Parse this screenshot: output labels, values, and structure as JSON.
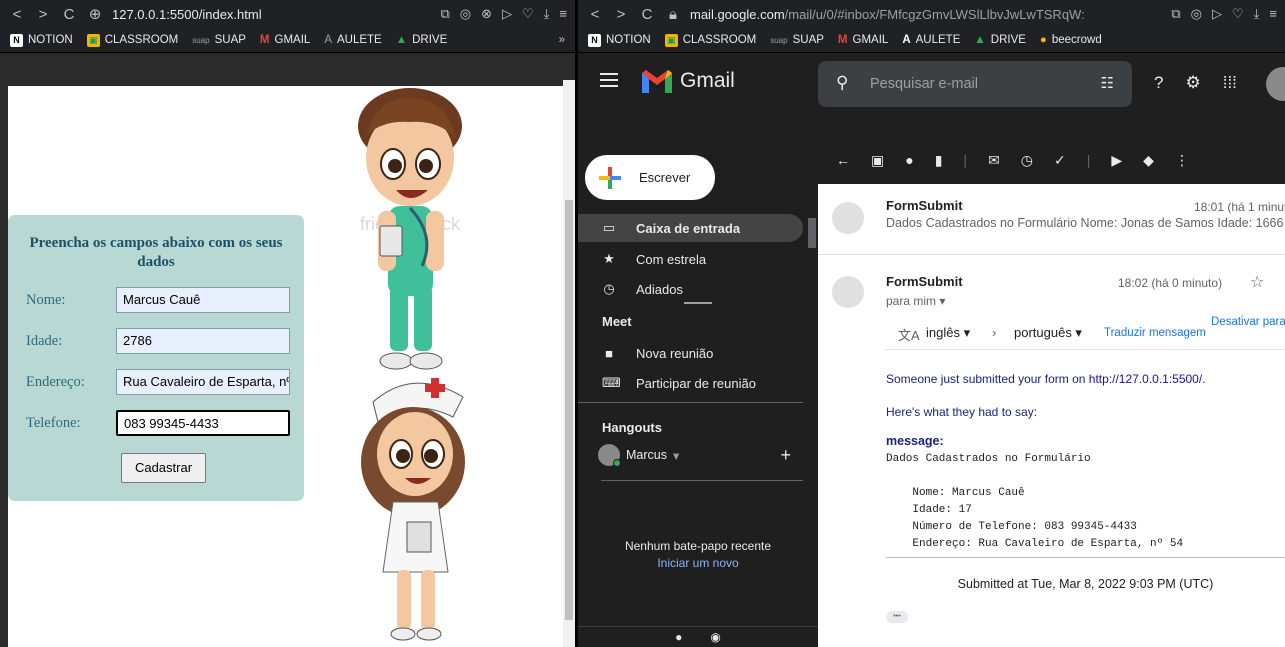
{
  "left_browser": {
    "url": "127.0.0.1:5500/index.html",
    "bookmarks": [
      "NOTION",
      "CLASSROOM",
      "SUAP",
      "GMAIL",
      "AULETE",
      "DRIVE"
    ],
    "bookmark_suap_prefix": "suap",
    "overflow": "»"
  },
  "form": {
    "title": "Preencha os campos abaixo com os seus dados",
    "fields": [
      {
        "label": "Nome:",
        "value": "Marcus Cauê"
      },
      {
        "label": "Idade:",
        "value": "2786"
      },
      {
        "label": "Endereço:",
        "value": "Rua Cavaleiro de Esparta, nº"
      },
      {
        "label": "Telefone:",
        "value": "083 99345-4433"
      }
    ],
    "submit_label": "Cadastrar",
    "watermark": "friendlystock"
  },
  "right_browser": {
    "url_host": "mail.google.com",
    "url_path": "/mail/u/0/#inbox/FMfcgzGmvLWSlLlbvJwLwTSRqW:",
    "bookmarks": [
      "NOTION",
      "CLASSROOM",
      "SUAP",
      "GMAIL",
      "AULETE",
      "DRIVE",
      "beecrowd"
    ],
    "bookmark_suap_prefix": "suap"
  },
  "gmail": {
    "logo_text": "Gmail",
    "search_placeholder": "Pesquisar e-mail",
    "compose_label": "Escrever",
    "nav": [
      {
        "label": "Caixa de entrada",
        "icon": "inbox-icon",
        "active": true
      },
      {
        "label": "Com estrela",
        "icon": "star-icon",
        "active": false
      },
      {
        "label": "Adiados",
        "icon": "clock-icon",
        "active": false
      }
    ],
    "meet_title": "Meet",
    "meet_items": [
      {
        "label": "Nova reunião",
        "icon": "video-icon"
      },
      {
        "label": "Participar de reunião",
        "icon": "keyboard-icon"
      }
    ],
    "hangouts_title": "Hangouts",
    "hangouts_user": "Marcus",
    "no_chat": "Nenhum bate-papo recente",
    "start_new": "Iniciar um novo",
    "messages": [
      {
        "sender": "FormSubmit",
        "time": "18:01 (há 1 minut",
        "snippet": "Dados Cadastrados no Formulário Nome: Jonas de Samos Idade: 1666"
      },
      {
        "sender": "FormSubmit",
        "time": "18:02 (há 0 minuto)",
        "to": "para mim ▾"
      }
    ],
    "translate": {
      "from": "inglês ▾",
      "arrow": "›",
      "to": "português ▾",
      "action": "Traduzir mensagem",
      "disable": "Desativar para"
    },
    "body": {
      "intro": "Someone just submitted your form on ",
      "link": "http://127.0.0.1:5500/",
      "intro_end": ".",
      "said": "Here's what they had to say:",
      "key": "message:",
      "lines": [
        "Dados Cadastrados no Formulário",
        "",
        "    Nome: Marcus Cauê",
        "    Idade: 17",
        "    Número de Telefone: 083 99345-4433",
        "    Endereço: Rua Cavaleiro de Esparta, nº 54"
      ],
      "submitted": "Submitted at Tue, Mar 8, 2022 9:03 PM (UTC)",
      "ellipsis": "•••"
    }
  }
}
